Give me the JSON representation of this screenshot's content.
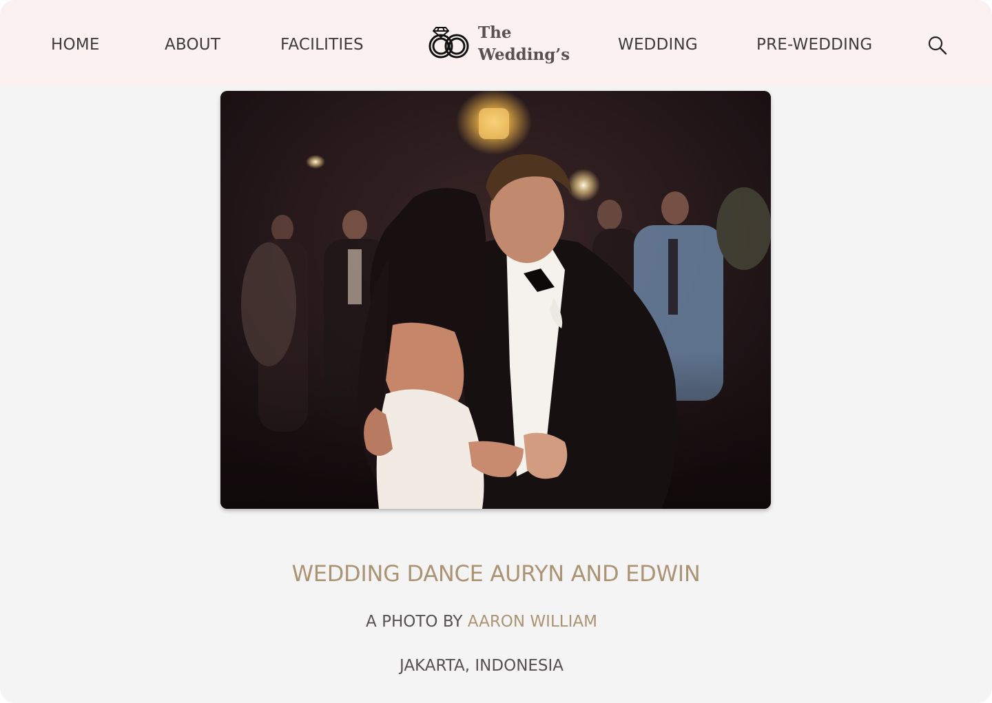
{
  "nav": {
    "home": "HOME",
    "about": "ABOUT",
    "facilities": "FACILITIES",
    "wedding": "WEDDING",
    "pre_wedding": "PRE-WEDDING",
    "search_icon": "search-icon"
  },
  "logo": {
    "line1": "The",
    "line2": "Wedding’s",
    "icon": "wedding-rings-icon"
  },
  "photo": {
    "alt": "Wedding couple dancing"
  },
  "caption": {
    "title": "WEDDING DANCE AURYN AND EDWIN",
    "credit_prefix": "A PHOTO BY",
    "photographer": "AARON WILLIAM",
    "location": "JAKARTA, INDONESIA"
  },
  "colors": {
    "navbar_bg": "#fbf1f0",
    "page_bg": "#f4f4f4",
    "accent_gold": "#ab9474",
    "text_dark": "#3f3b3c"
  }
}
